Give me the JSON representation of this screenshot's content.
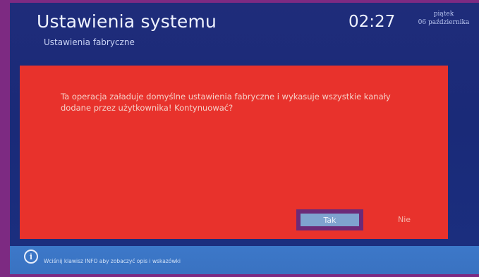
{
  "header": {
    "title": "Ustawienia systemu",
    "subtitle": "Ustawienia fabryczne",
    "time": "02:27",
    "date_line1": "piątek",
    "date_line2": "06 października"
  },
  "dialog": {
    "message": "Ta operacja załaduje domyślne ustawienia fabryczne i wykasuje wszystkie kanały dodane przez użytkownika! Kontynuować?",
    "yes_label": "Tak",
    "no_label": "Nie",
    "selected": "Tak"
  },
  "footer": {
    "icon": "info-icon",
    "hint": "Wciśnij klawisz INFO aby zobaczyć opis i wskazówki"
  },
  "colors": {
    "frame": "#7d2a82",
    "background": "#1f2c7a",
    "dialog": "#e8322c",
    "selected_button": "#7fa3cf",
    "infobar": "#3c78c9"
  }
}
